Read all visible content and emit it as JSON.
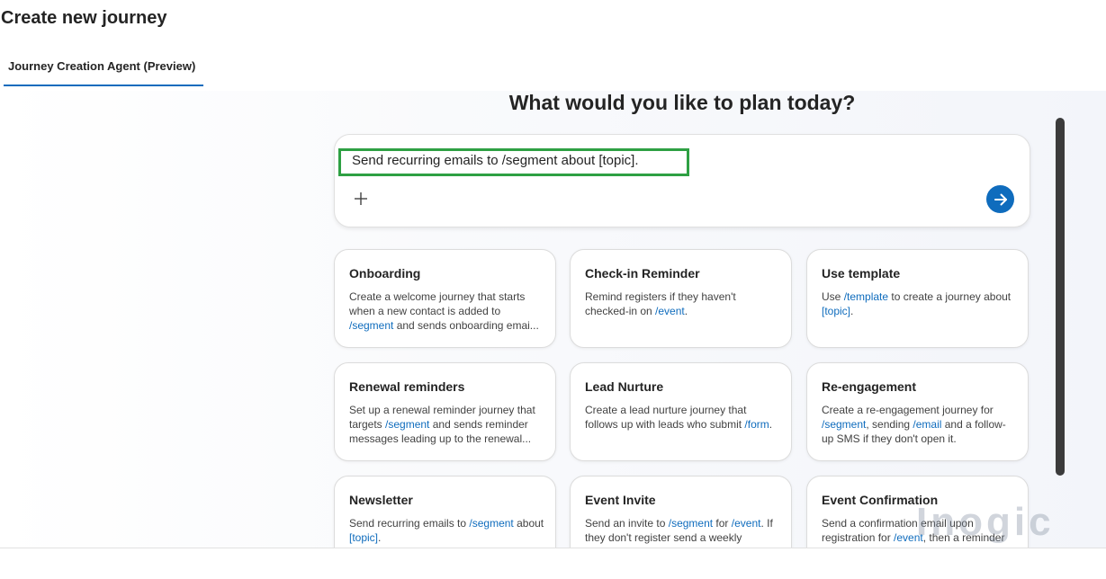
{
  "page": {
    "title": "Create new journey"
  },
  "tabs": [
    {
      "label": "Journey Creation Agent (Preview)",
      "selected": true
    }
  ],
  "main": {
    "heading": "What would you like to plan today?",
    "prompt": {
      "value": "Send recurring emails to /segment about [topic].",
      "add_icon": "plus-icon",
      "send_icon": "arrow-right-icon"
    },
    "cards": [
      {
        "title": "Onboarding",
        "desc": [
          {
            "t": "Create a welcome journey that starts when a new contact is added to "
          },
          {
            "t": "/segment",
            "token": true
          },
          {
            "t": " and sends onboarding emai..."
          }
        ]
      },
      {
        "title": "Check-in Reminder",
        "desc": [
          {
            "t": "Remind registers if they haven't checked-in on "
          },
          {
            "t": "/event",
            "token": true
          },
          {
            "t": "."
          }
        ]
      },
      {
        "title": "Use template",
        "desc": [
          {
            "t": "Use "
          },
          {
            "t": "/template",
            "token": true
          },
          {
            "t": " to create a journey about "
          },
          {
            "t": "[topic]",
            "token": true
          },
          {
            "t": "."
          }
        ]
      },
      {
        "title": "Renewal reminders",
        "desc": [
          {
            "t": "Set up a renewal reminder journey that targets "
          },
          {
            "t": "/segment",
            "token": true
          },
          {
            "t": " and sends reminder messages leading up to the renewal..."
          }
        ]
      },
      {
        "title": "Lead Nurture",
        "desc": [
          {
            "t": "Create a lead nurture journey that follows up with leads who submit "
          },
          {
            "t": "/form",
            "token": true
          },
          {
            "t": "."
          }
        ]
      },
      {
        "title": "Re-engagement",
        "desc": [
          {
            "t": "Create a re-engagement journey for "
          },
          {
            "t": "/segment",
            "token": true
          },
          {
            "t": ", sending "
          },
          {
            "t": "/email",
            "token": true
          },
          {
            "t": " and a follow-up SMS if they don't open it."
          }
        ]
      },
      {
        "title": "Newsletter",
        "desc": [
          {
            "t": "Send recurring emails to "
          },
          {
            "t": "/segment",
            "token": true
          },
          {
            "t": " about "
          },
          {
            "t": "[topic]",
            "token": true
          },
          {
            "t": "."
          }
        ]
      },
      {
        "title": "Event Invite",
        "desc": [
          {
            "t": "Send an invite to "
          },
          {
            "t": "/segment",
            "token": true
          },
          {
            "t": " for "
          },
          {
            "t": "/event",
            "token": true
          },
          {
            "t": ". If they don't register send a weekly"
          }
        ]
      },
      {
        "title": "Event Confirmation",
        "desc": [
          {
            "t": "Send a confirmation email upon registration for "
          },
          {
            "t": "/event",
            "token": true
          },
          {
            "t": ", then a reminder"
          }
        ]
      }
    ]
  },
  "watermark": {
    "text": "Inogic"
  },
  "colors": {
    "accent": "#0f6cbd",
    "highlight": "#2ea043",
    "token": "#0f6cbd"
  }
}
